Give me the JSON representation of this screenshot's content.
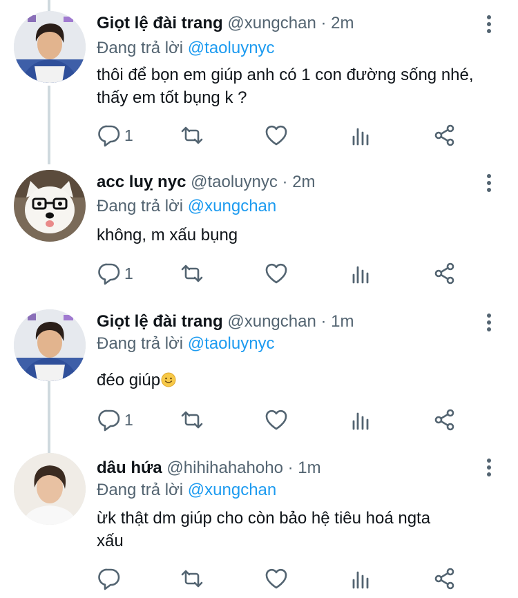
{
  "colors": {
    "name": "#0f1419",
    "secondary": "#536471",
    "mention": "#1d9bf0",
    "thread_line": "#cfd9de"
  },
  "icons": {
    "more": "three-dots-vertical-icon",
    "reply": "speech-bubble-icon",
    "retweet": "retweet-arrows-icon",
    "like": "heart-outline-icon",
    "stats": "bar-chart-icon",
    "share": "share-nodes-icon"
  },
  "tweets": [
    {
      "name": "Giọt lệ đài trang",
      "handle": "@xungchan",
      "separator": "·",
      "time": "2m",
      "reply_prefix": "Đang trả lời",
      "reply_to": "@taoluynyc",
      "text": "thôi để bọn em giúp anh có 1 con đường sống nhé, thấy em tốt bụng k ?",
      "reply_count": "1"
    },
    {
      "name": "acc luỵ nyc",
      "handle": "@taoluynyc",
      "separator": "·",
      "time": "2m",
      "reply_prefix": "Đang trả lời",
      "reply_to": "@xungchan",
      "text": "không, m xấu bụng",
      "reply_count": "1"
    },
    {
      "name": "Giọt lệ đài trang",
      "handle": "@xungchan",
      "separator": "·",
      "time": "1m",
      "reply_prefix": "Đang trả lời",
      "reply_to": "@taoluynyc",
      "text": "đéo giúp",
      "reply_count": "1"
    },
    {
      "name": "dâu hứa",
      "handle": "@hihihahahoho",
      "separator": "·",
      "time": "1m",
      "reply_prefix": "Đang trả lời",
      "reply_to": "@xungchan",
      "text": "ừk thật dm giúp cho còn bảo hệ tiêu hoá ngta xấu",
      "reply_count": ""
    }
  ]
}
